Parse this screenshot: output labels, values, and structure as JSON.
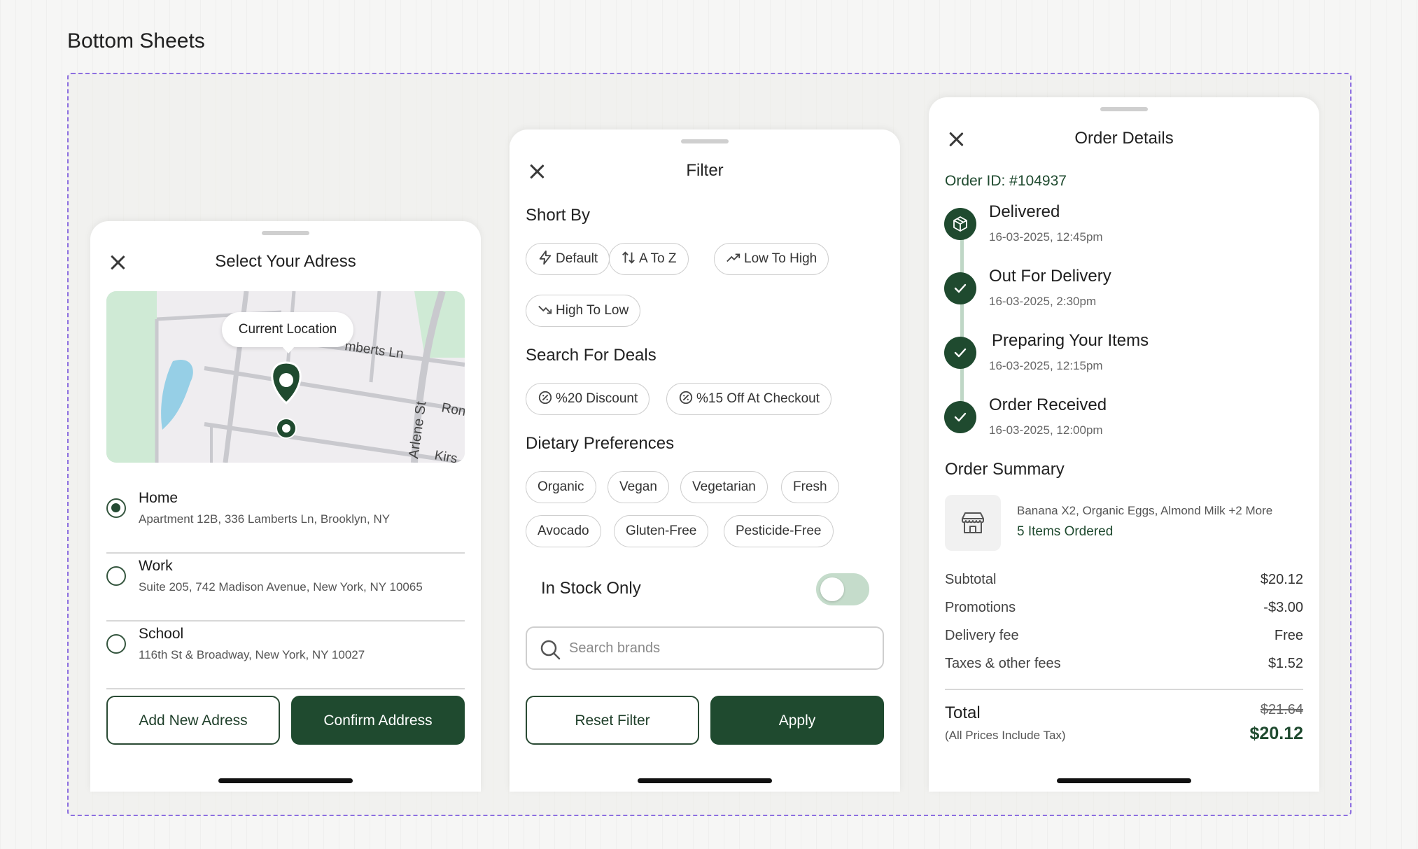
{
  "page": {
    "title": "Bottom Sheets"
  },
  "address_sheet": {
    "title": "Select Your Adress",
    "map": {
      "bubble": "Current Location",
      "street_labels": [
        "mberts Ln",
        "Arlene St",
        "Ron",
        "Kirs"
      ]
    },
    "addresses": [
      {
        "name": "Home",
        "line": "Apartment 12B, 336 Lamberts Ln, Brooklyn, NY",
        "selected": true
      },
      {
        "name": "Work",
        "line": "Suite 205, 742 Madison Avenue, New York, NY 10065",
        "selected": false
      },
      {
        "name": "School",
        "line": "116th St & Broadway, New York, NY 10027",
        "selected": false
      }
    ],
    "add_button": "Add New Adress",
    "confirm_button": "Confirm Address"
  },
  "filter_sheet": {
    "title": "Filter",
    "sort_label": "Short By",
    "sort_options": [
      "Default",
      "A To Z",
      "Low To High",
      "High To Low"
    ],
    "deals_label": "Search For Deals",
    "deals": [
      "%20 Discount",
      "%15 Off At Checkout"
    ],
    "diet_label": "Dietary Preferences",
    "diet_options": [
      "Organic",
      "Vegan",
      "Vegetarian",
      "Fresh",
      "Avocado",
      "Gluten-Free",
      "Pesticide-Free"
    ],
    "stock_label": "In Stock Only",
    "stock_enabled": false,
    "search_placeholder": "Search brands",
    "reset_button": "Reset Filter",
    "apply_button": "Apply"
  },
  "order_sheet": {
    "title": "Order Details",
    "order_id": "Order ID: #104937",
    "timeline": [
      {
        "status": "Delivered",
        "time": "16-03-2025, 12:45pm",
        "icon": "package-icon"
      },
      {
        "status": "Out For Delivery",
        "time": "16-03-2025, 2:30pm",
        "icon": "check-icon"
      },
      {
        "status": "Preparing Your Items",
        "time": "16-03-2025, 12:15pm",
        "icon": "check-icon"
      },
      {
        "status": "Order Received",
        "time": "16-03-2025, 12:00pm",
        "icon": "check-icon"
      }
    ],
    "summary_label": "Order Summary",
    "summary_items": "Banana X2, Organic Eggs, Almond Milk +2 More",
    "summary_count": "5 Items Ordered",
    "fees": [
      {
        "label": "Subtotal",
        "value": "$20.12"
      },
      {
        "label": "Promotions",
        "value": "-$3.00"
      },
      {
        "label": "Delivery fee",
        "value": "Free"
      },
      {
        "label": "Taxes & other fees",
        "value": "$1.52"
      }
    ],
    "total_label": "Total",
    "total_note": "(All Prices Include Tax)",
    "total_original": "$21.64",
    "total_final": "$20.12"
  },
  "colors": {
    "brand_green": "#1f4a2f",
    "frame_border": "#8d6fe0"
  }
}
